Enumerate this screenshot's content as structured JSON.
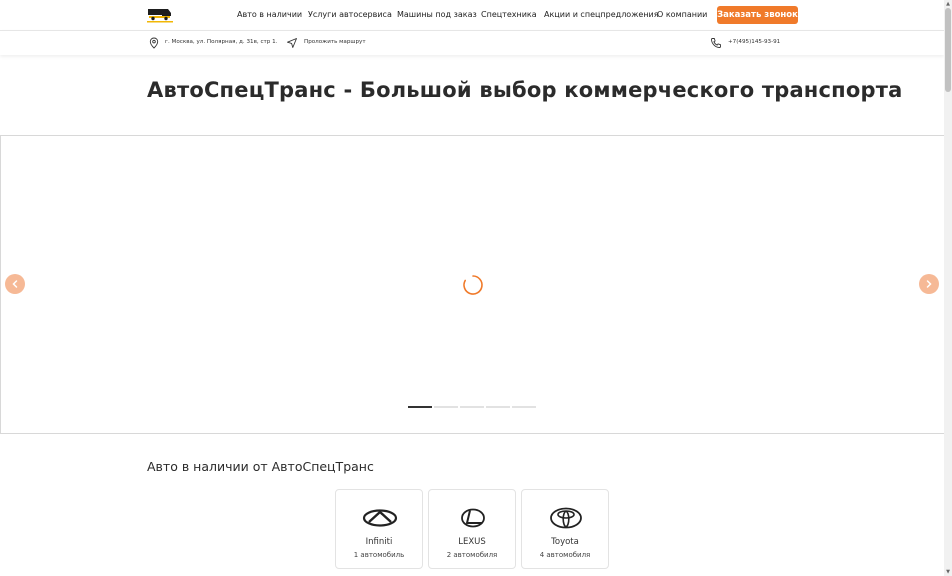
{
  "nav": {
    "items": [
      {
        "label": "Авто в наличии"
      },
      {
        "label": "Услуги автосервиса"
      },
      {
        "label": "Машины под заказ"
      },
      {
        "label": "Спецтехника"
      },
      {
        "label": "Акции и спецпредложения"
      },
      {
        "label": "О компании"
      }
    ],
    "cta_label": "Заказать звонок"
  },
  "info": {
    "address": "г. Москва, ул. Полярная, д. 31в, стр 1.",
    "route_label": "Проложить маршрут",
    "phone": "+7(495)145-93-91"
  },
  "hero": {
    "title": "АвтоСпецТранс - Большой выбор коммерческого транспорта"
  },
  "slider": {
    "slide_count": 5,
    "active_index": 0
  },
  "brands_section": {
    "title": "Авто в наличии от АвтоСпецТранс",
    "brands": [
      {
        "name": "Infiniti",
        "count": "1 автомобиль",
        "icon": "infiniti-logo-icon"
      },
      {
        "name": "LEXUS",
        "count": "2 автомобиля",
        "icon": "lexus-logo-icon"
      },
      {
        "name": "Toyota",
        "count": "4 автомобиля",
        "icon": "toyota-logo-icon"
      }
    ]
  },
  "colors": {
    "accent": "#f07a2a",
    "arrow_bg": "#f6b996",
    "text": "#2b2b2b"
  }
}
